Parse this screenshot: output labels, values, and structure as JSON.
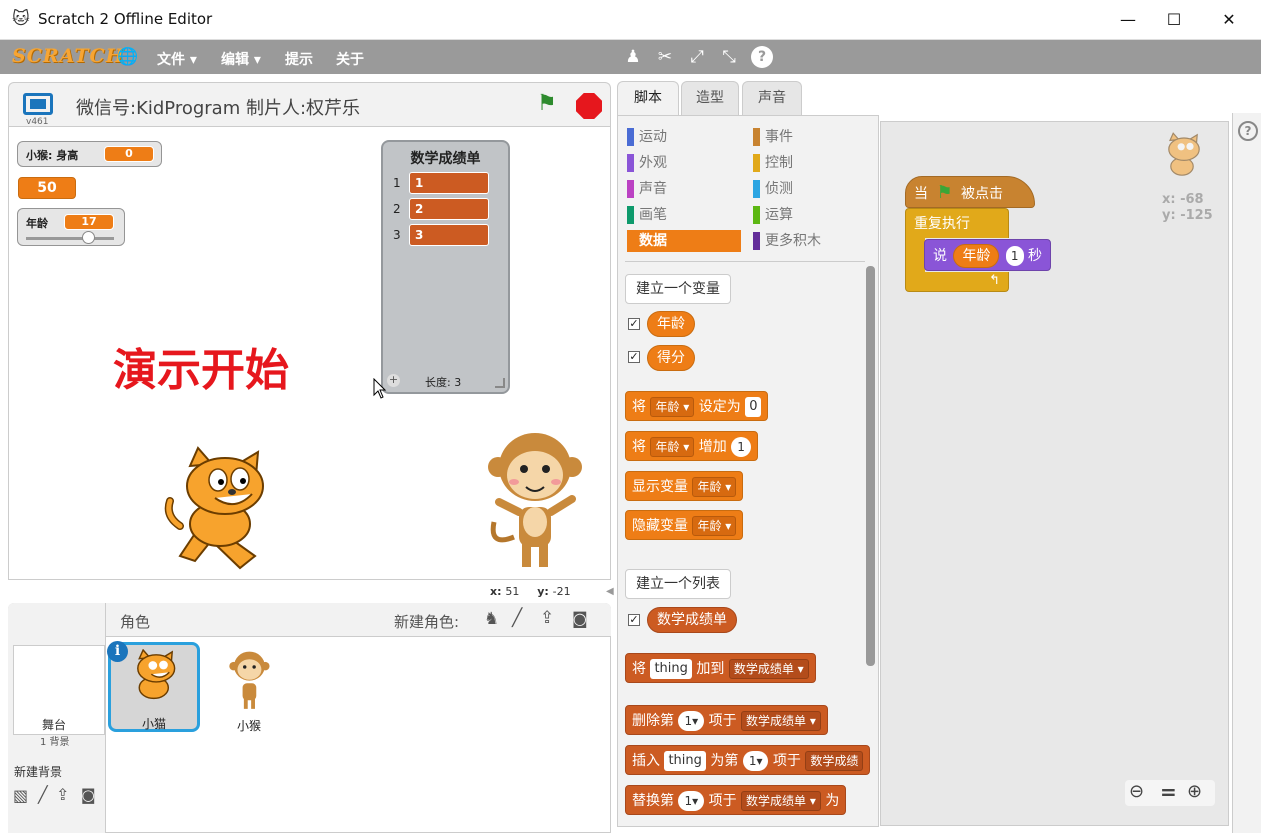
{
  "window": {
    "title": "Scratch 2 Offline Editor",
    "min": "—",
    "max": "☐",
    "close": "✕"
  },
  "menubar": {
    "logo": "SCRATCH",
    "items": [
      "文件 ▾",
      "编辑 ▾",
      "提示",
      "关于"
    ]
  },
  "stage": {
    "title": "微信号:KidProgram 制片人:权芹乐",
    "version": "v461",
    "banner": "演示开始",
    "coords": {
      "x_label": "x:",
      "x": "51",
      "y_label": "y:",
      "y": "-21"
    },
    "monitors": [
      {
        "label": "小猴: 身高",
        "value": "0"
      },
      {
        "label": "",
        "value": "50"
      },
      {
        "label": "年龄",
        "value": "17",
        "slider": 0.7
      }
    ],
    "list_monitor": {
      "title": "数学成绩单",
      "items": [
        "1",
        "2",
        "3"
      ],
      "indices": [
        "1",
        "2",
        "3"
      ],
      "plus": "+",
      "length": "长度: 3"
    }
  },
  "sprites": {
    "header": "角色",
    "new_sprite": "新建角色:",
    "stage_label": "舞台",
    "stage_sub": "1 背景",
    "new_backdrop": "新建背景",
    "items": [
      {
        "name": "小猫",
        "selected": true
      },
      {
        "name": "小猴",
        "selected": false
      }
    ]
  },
  "tabs": [
    "脚本",
    "造型",
    "声音"
  ],
  "categories": [
    {
      "name": "运动",
      "color": "#4a6cd4"
    },
    {
      "name": "事件",
      "color": "#c88330"
    },
    {
      "name": "外观",
      "color": "#8a55d7"
    },
    {
      "name": "控制",
      "color": "#e1a91a"
    },
    {
      "name": "声音",
      "color": "#bb42c3"
    },
    {
      "name": "侦测",
      "color": "#2ca5e2"
    },
    {
      "name": "画笔",
      "color": "#0e9a6c"
    },
    {
      "name": "运算",
      "color": "#5cb712"
    },
    {
      "name": "数据",
      "color": "#ee7d16"
    },
    {
      "name": "更多积木",
      "color": "#632d99"
    }
  ],
  "palette": {
    "make_var": "建立一个变量",
    "vars": [
      "年龄",
      "得分"
    ],
    "set": {
      "a": "将",
      "var": "年龄 ▾",
      "b": "设定为",
      "val": "0"
    },
    "change": {
      "a": "将",
      "var": "年龄 ▾",
      "b": "增加",
      "val": "1"
    },
    "show": {
      "a": "显示变量",
      "var": "年龄 ▾"
    },
    "hide": {
      "a": "隐藏变量",
      "var": "年龄 ▾"
    },
    "make_list": "建立一个列表",
    "list_name": "数学成绩单",
    "add": {
      "a": "将",
      "slot": "thing",
      "b": "加到",
      "list": "数学成绩单 ▾"
    },
    "delete": {
      "a": "删除第",
      "n": "1▾",
      "b": "项于",
      "list": "数学成绩单 ▾"
    },
    "insert": {
      "a": "插入",
      "slot": "thing",
      "b": "为第",
      "n": "1▾",
      "c": "项于",
      "list": "数学成绩"
    },
    "replace": {
      "a": "替换第",
      "n": "1▾",
      "b": "项于",
      "list": "数学成绩单 ▾",
      "c": "为"
    }
  },
  "script": {
    "hat": {
      "a": "当",
      "b": "被点击"
    },
    "repeat": "重复执行",
    "say": {
      "a": "说",
      "var": "年龄",
      "n": "1",
      "b": "秒"
    },
    "sprite_x": "x: -68",
    "sprite_y": "y: -125"
  },
  "colors": {
    "data": "#ee7d16",
    "list": "#cc5b22",
    "events": "#c88330",
    "control": "#e1a91a",
    "looks": "#8a55d7",
    "banner": "#e6171d"
  }
}
